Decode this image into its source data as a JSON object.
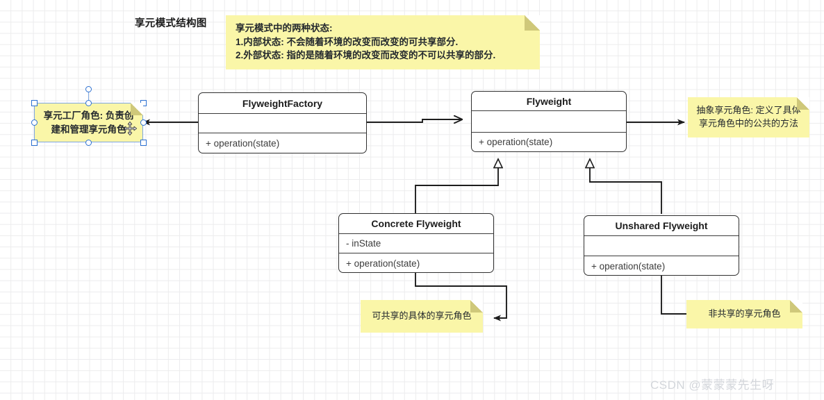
{
  "canvas": {
    "title": "享元模式结构图",
    "watermark": "CSDN @蒙蒙蒙先生呀",
    "grid_color": "#ececed",
    "background": "#ffffff"
  },
  "notes": {
    "info": {
      "text": "享元模式中的两种状态:\n1.内部状态: 不会随着环境的改变而改变的可共享部分.\n2.外部状态: 指的是随着环境的改变而改变的不可以共享的部分.",
      "color": "#faf6a8"
    },
    "factory_role": {
      "text": "享元工厂角色: 负责创\n建和管理享元角色",
      "color": "#faf6a8",
      "selected": true
    },
    "abstract_role": {
      "text": "抽象享元角色: 定义了具体\n享元角色中的公共的方法",
      "color": "#faf6a8"
    },
    "concrete_role": {
      "text": "可共享的具体的享元角色",
      "color": "#faf6a8"
    },
    "unshared_role": {
      "text": "非共享的享元角色",
      "color": "#faf6a8"
    }
  },
  "classes": {
    "flyweight_factory": {
      "name": "FlyweightFactory",
      "attributes": [
        ""
      ],
      "operations": [
        "+ operation(state)"
      ]
    },
    "flyweight": {
      "name": "Flyweight",
      "attributes": [
        ""
      ],
      "operations": [
        "+ operation(state)"
      ]
    },
    "concrete_flyweight": {
      "name": "Concrete Flyweight",
      "attributes": [
        "- inState"
      ],
      "operations": [
        "+ operation(state)"
      ]
    },
    "unshared_flyweight": {
      "name": "Unshared Flyweight",
      "attributes": [
        ""
      ],
      "operations": [
        "+ operation(state)"
      ]
    }
  },
  "connectors": {
    "factory_to_flyweight": {
      "type": "association",
      "arrow": "open"
    },
    "factory_to_note": {
      "type": "note-link",
      "arrow": "filled"
    },
    "flyweight_to_note": {
      "type": "note-link",
      "arrow": "filled"
    },
    "concrete_generalization": {
      "type": "generalization",
      "arrow": "hollow-triangle"
    },
    "unshared_generalization": {
      "type": "generalization",
      "arrow": "hollow-triangle"
    },
    "concrete_to_note": {
      "type": "note-link",
      "arrow": "filled"
    },
    "unshared_to_note": {
      "type": "note-link",
      "arrow": "filled"
    }
  }
}
